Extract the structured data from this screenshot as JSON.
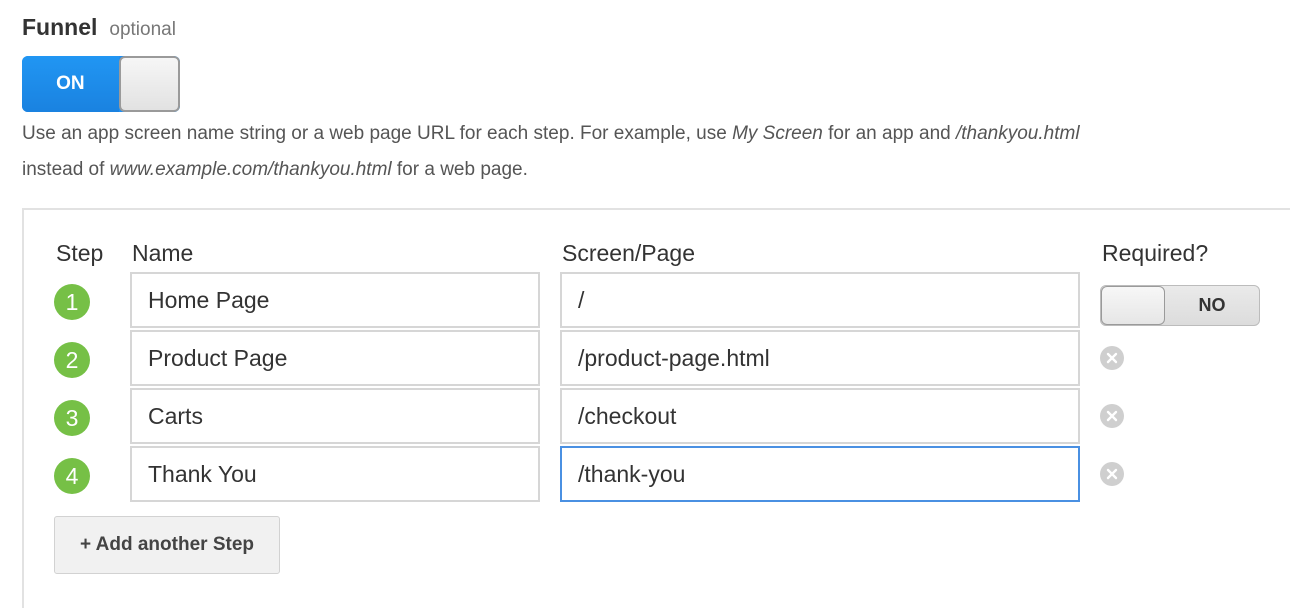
{
  "header": {
    "title": "Funnel",
    "optional_label": "optional",
    "funnel_toggle": {
      "label": "ON",
      "state": "on"
    }
  },
  "help_text": {
    "part1": "Use an app screen name string or a web page URL for each step. For example, use ",
    "example_app": "My Screen",
    "part2": " for an app and ",
    "example_url": "/thankyou.html",
    "part3": " instead of ",
    "example_full_url": "www.example.com/thankyou.html",
    "part4": " for a web page."
  },
  "table": {
    "columns": {
      "step": "Step",
      "name": "Name",
      "page": "Screen/Page",
      "required": "Required?"
    },
    "required_toggle": {
      "label": "NO",
      "state": "off"
    },
    "steps": [
      {
        "number": "1",
        "name": "Home Page",
        "page": "/"
      },
      {
        "number": "2",
        "name": "Product Page",
        "page": "/product-page.html"
      },
      {
        "number": "3",
        "name": "Carts",
        "page": "/checkout"
      },
      {
        "number": "4",
        "name": "Thank You",
        "page": "/thank-you"
      }
    ],
    "add_step_label": "+ Add another Step"
  },
  "colors": {
    "toggle_on": "#1e8ef1",
    "step_badge": "#76c046",
    "focus_border": "#4a90e2",
    "remove_icon": "#cfcfcf"
  }
}
